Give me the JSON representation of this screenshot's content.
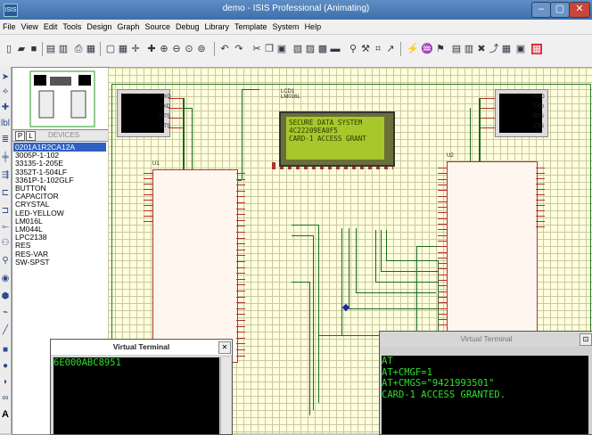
{
  "window": {
    "app_icon": "ISIS",
    "title": "demo - ISIS Professional (Animating)",
    "min_glyph": "–",
    "max_glyph": "▢",
    "close_glyph": "✕"
  },
  "menu": [
    "File",
    "View",
    "Edit",
    "Tools",
    "Design",
    "Graph",
    "Source",
    "Debug",
    "Library",
    "Template",
    "System",
    "Help"
  ],
  "device_panel": {
    "p_label": "P",
    "l_label": "L",
    "header": "DEVICES",
    "items": [
      "0201A1R2CA12A",
      "3005P-1-102",
      "33135-1-205E",
      "3352T-1-504LF",
      "3361P-1-102GLF",
      "BUTTON",
      "CAPACITOR",
      "CRYSTAL",
      "LED-YELLOW",
      "LM016L",
      "LM044L",
      "LPC2138",
      "RES",
      "RES-VAR",
      "SW-SPST"
    ],
    "selected_index": 0
  },
  "schematic": {
    "lcd_ref": "LCD1",
    "lcd_part": "LM016L",
    "u1_ref": "U1",
    "u2_ref": "U2",
    "lcd_lines": [
      "SECURE DATA SYSTEM",
      "4C22209EA0F5",
      "CARD-1 ACCESS GRANT"
    ],
    "mini_pins": [
      "RXD",
      "TXD",
      "RTS",
      "CTS"
    ]
  },
  "terminal_left": {
    "title": "Virtual Terminal",
    "lines": [
      "6E000ABC8951"
    ]
  },
  "terminal_right": {
    "title": "Virtual Terminal",
    "lines": [
      "AT",
      "AT+CMGF=1",
      "AT+CMGS=\"9421993501\"",
      "CARD-1 ACCESS GRANTED."
    ]
  },
  "colors": {
    "titlebar": "#4a7ab7",
    "schematic_bg": "#ffffde",
    "wire": "#1a6a1a",
    "terminal_text": "#2ee02e",
    "lcd_screen": "#a7c72a"
  }
}
